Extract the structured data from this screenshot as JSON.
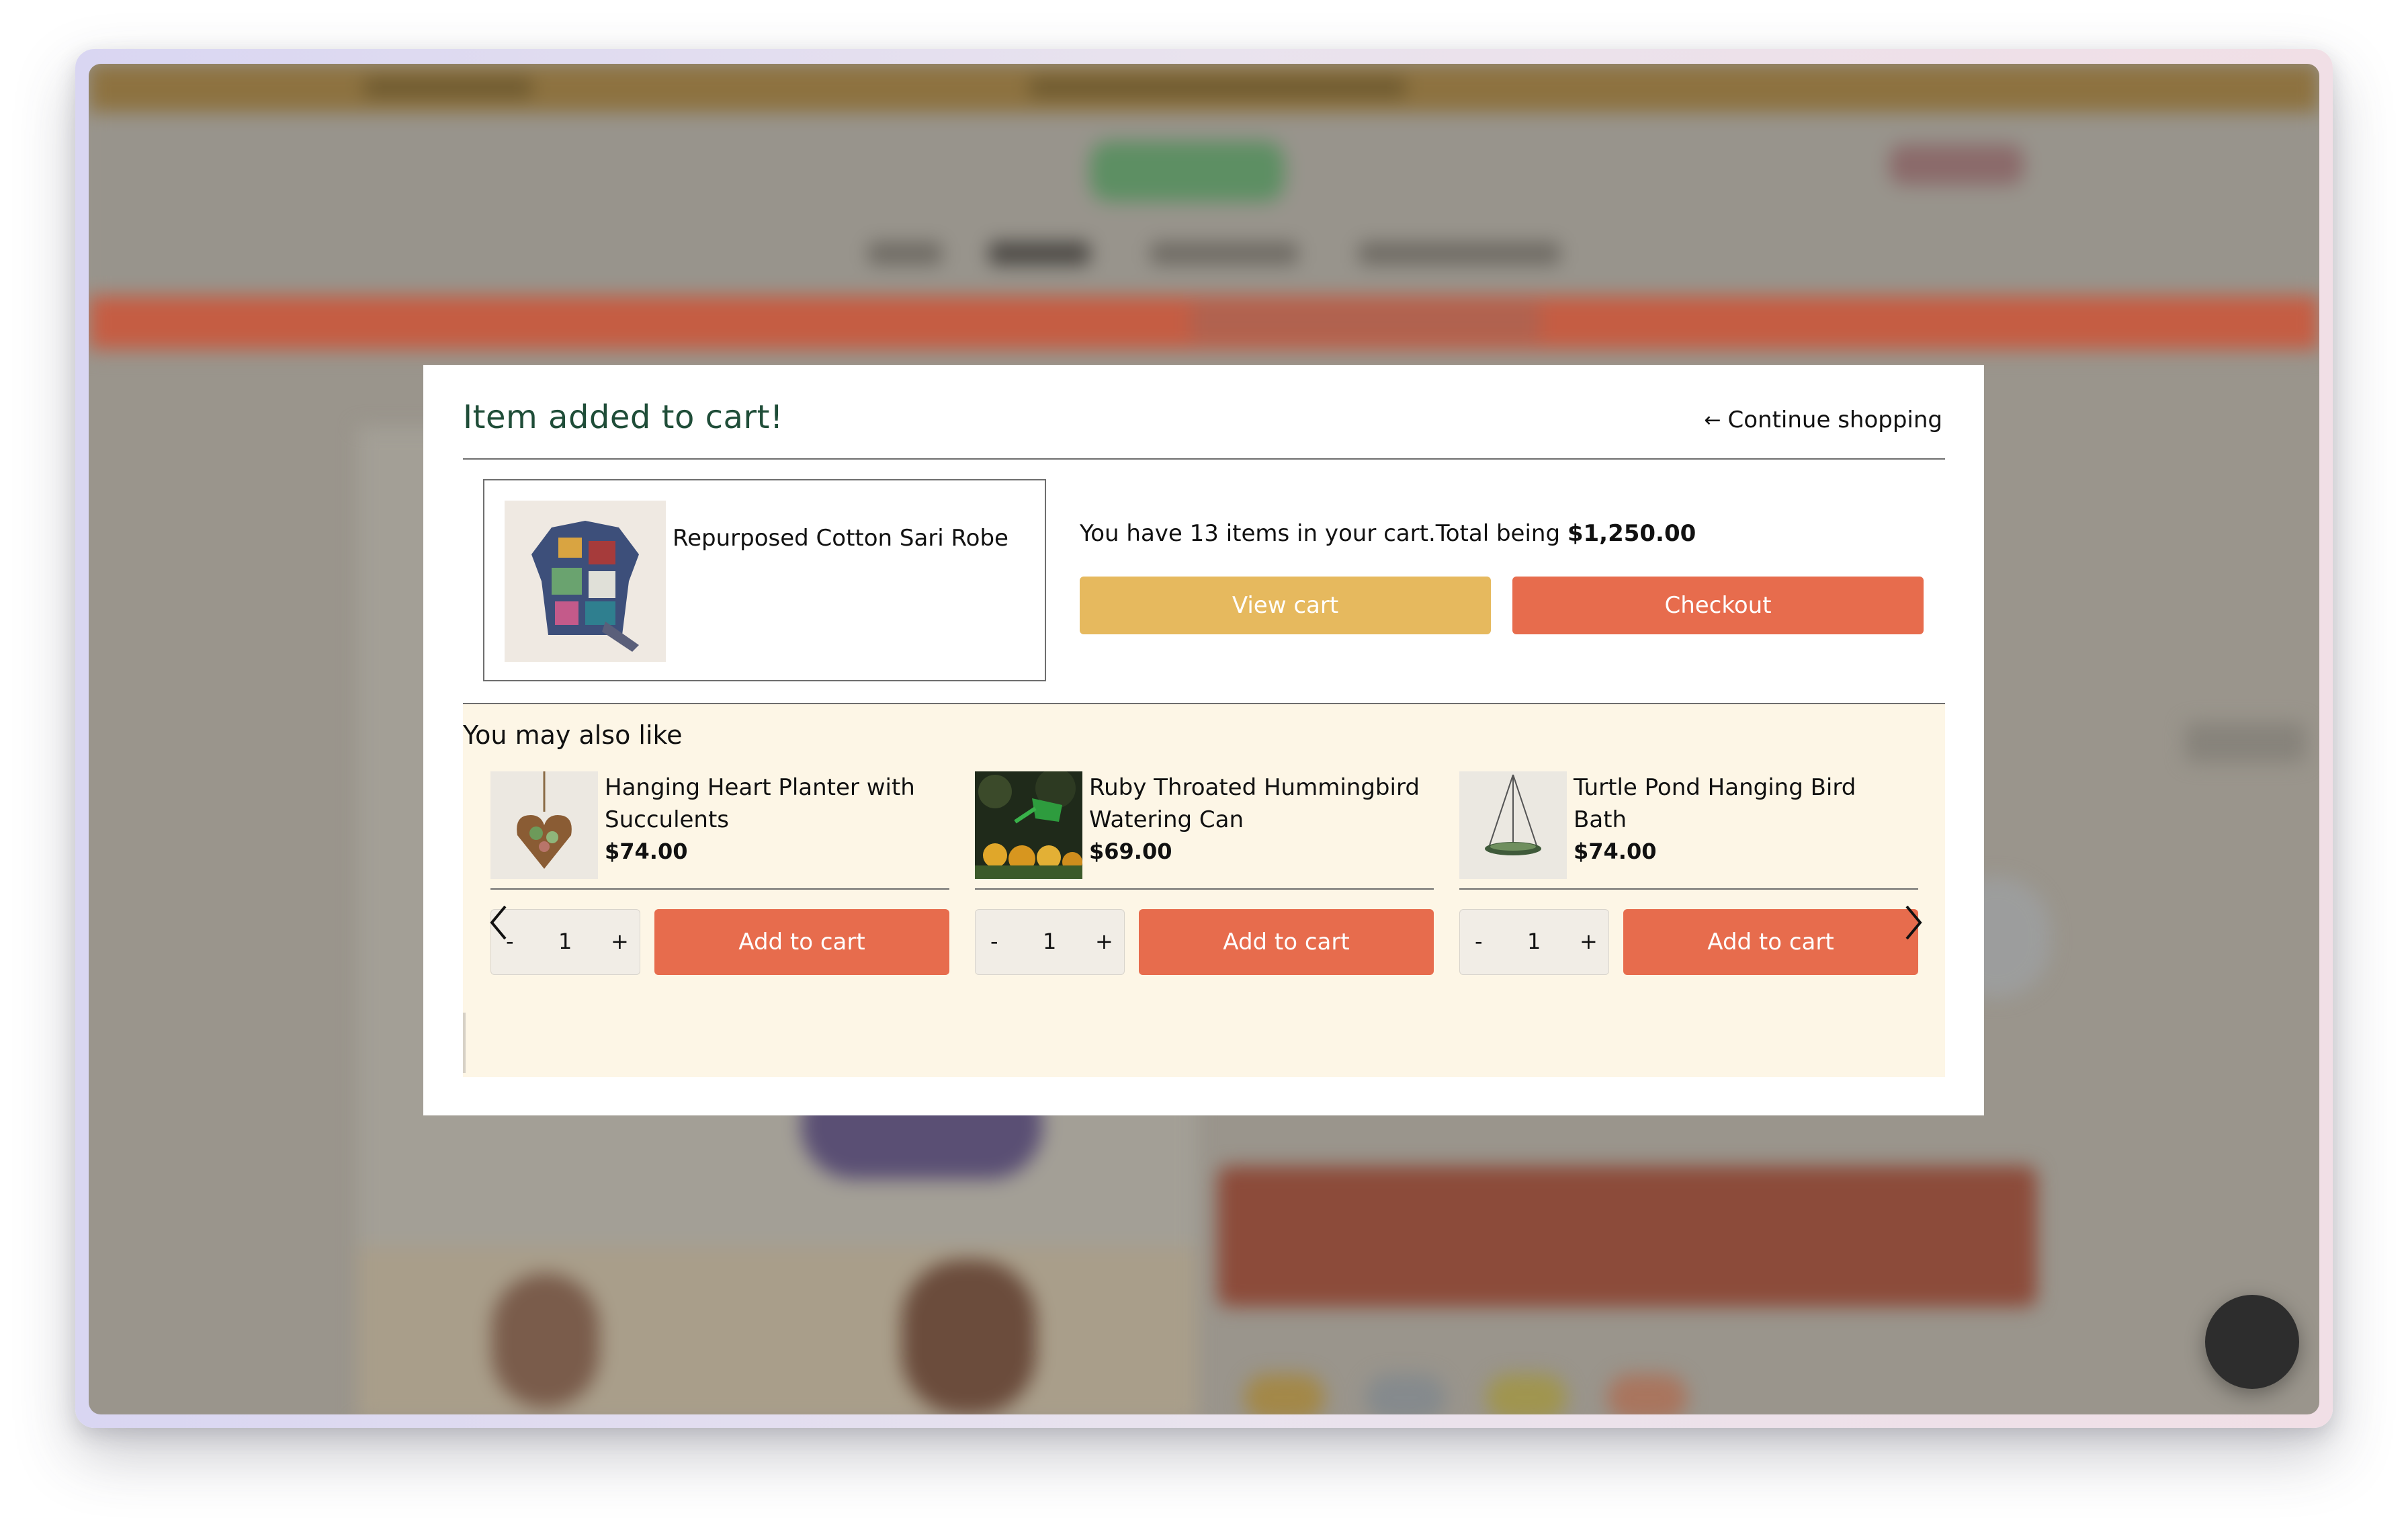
{
  "modal": {
    "title": "Item added to cart!",
    "continue_label": "Continue shopping",
    "continue_arrow": "←"
  },
  "added_item": {
    "name": "Repurposed Cotton Sari Robe"
  },
  "cart": {
    "summary_text": "You have 13 items in your cart.Total being ",
    "total": "$1,250.00",
    "view_cart_label": "View cart",
    "checkout_label": "Checkout"
  },
  "recommendations": {
    "title": "You may also like",
    "items": [
      {
        "name": "Hanging Heart Planter with Succulents",
        "price": "$74.00",
        "qty": "1",
        "minus": "-",
        "plus": "+",
        "add_label": "Add to cart"
      },
      {
        "name": "Ruby Throated Hummingbird Watering Can",
        "price": "$69.00",
        "qty": "1",
        "minus": "-",
        "plus": "+",
        "add_label": "Add to cart"
      },
      {
        "name": "Turtle Pond Hanging Bird Bath",
        "price": "$74.00",
        "qty": "1",
        "minus": "-",
        "plus": "+",
        "add_label": "Add to cart"
      }
    ]
  },
  "colors": {
    "title_green": "#1f4d38",
    "view_cart_yellow": "#e6b95e",
    "accent_orange": "#e76c4d",
    "recommend_bg": "#fdf6e6"
  },
  "icons": {
    "prev": "chevron-left-icon",
    "next": "chevron-right-icon",
    "continue": "arrow-left-icon"
  }
}
